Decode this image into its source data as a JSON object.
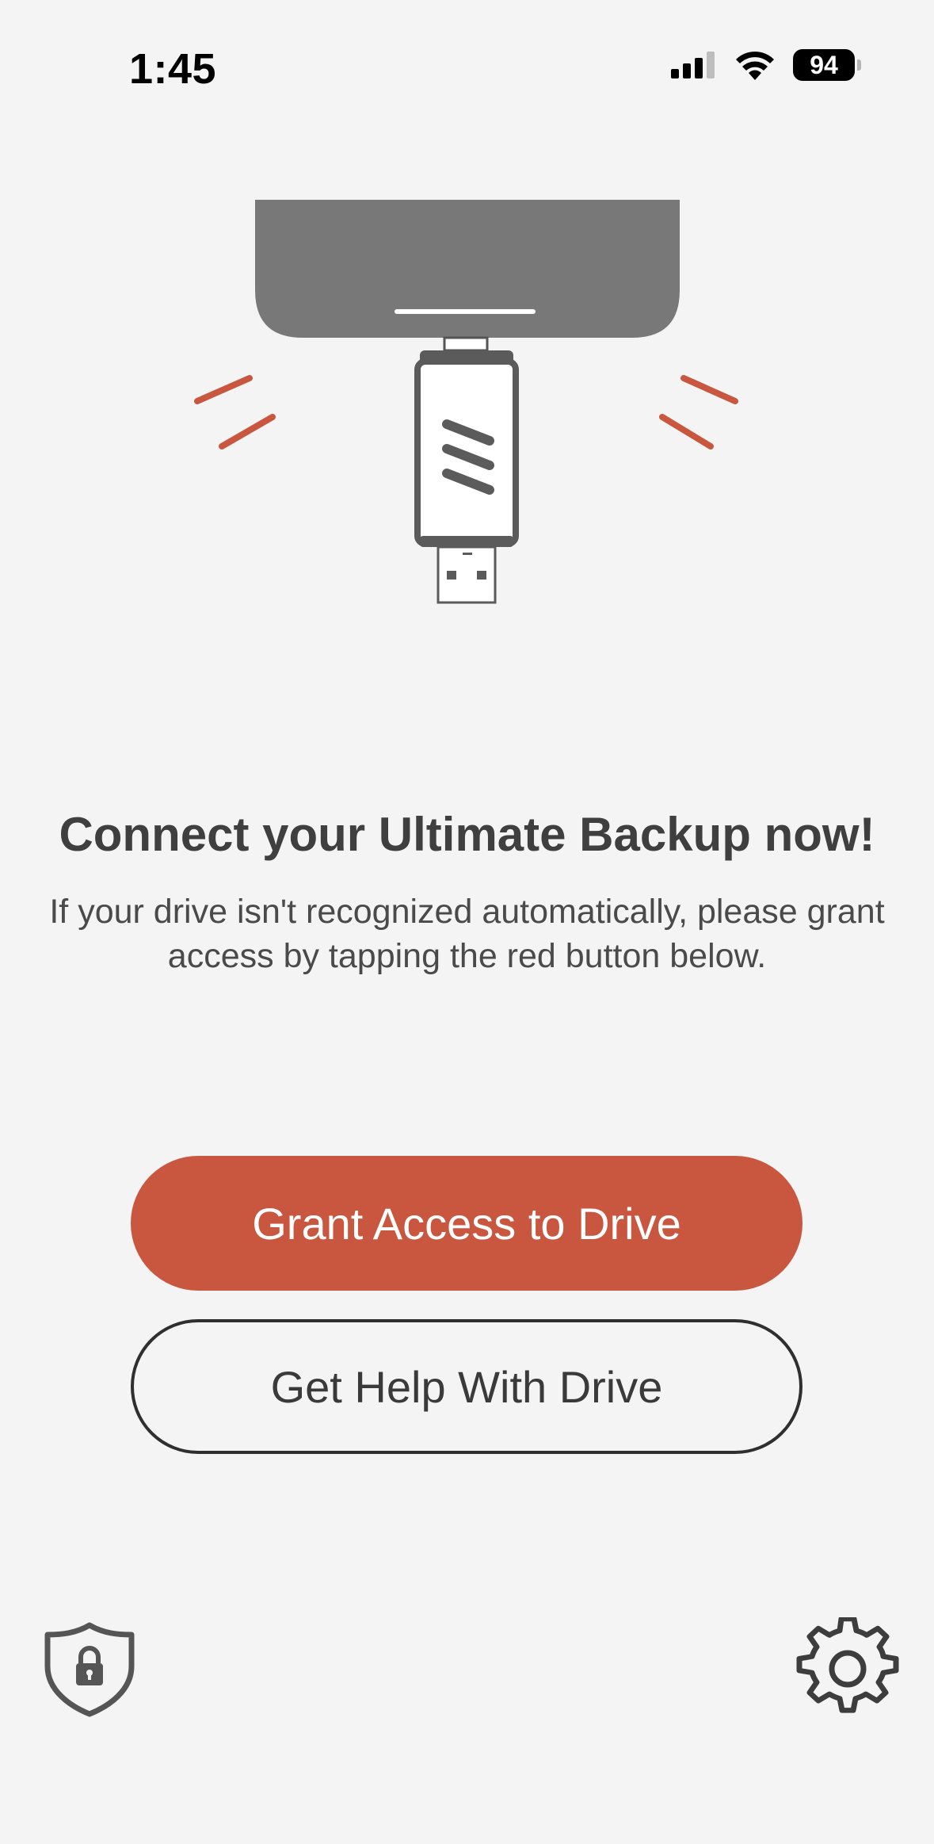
{
  "status_bar": {
    "time": "1:45",
    "battery_level": "94",
    "icons": [
      "cellular-signal-icon",
      "wifi-icon",
      "battery-icon"
    ]
  },
  "illustration": {
    "subject": "usb-drive-connecting-to-phone",
    "accent_color": "#c9573f",
    "device_color": "#787878"
  },
  "main": {
    "headline": "Connect your Ultimate Backup now!",
    "description": "If your drive isn't recognized automatically, please grant access by tapping the red button below."
  },
  "actions": {
    "grant_access_label": "Grant Access to Drive",
    "help_label": "Get Help With Drive"
  },
  "bottom_bar": {
    "left_icon": "shield-lock-icon",
    "right_icon": "gear-icon"
  },
  "colors": {
    "background": "#f4f4f4",
    "primary_button": "#c9573f",
    "text": "#3f3f3f"
  }
}
